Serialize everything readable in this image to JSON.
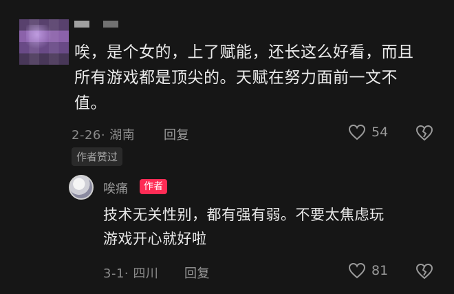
{
  "comment": {
    "text_line1": "唉，是个女的，上了赋能，还长这么好看，而且",
    "text_line2": "所有游戏都是顶尖的。天赋在努力面前一文不",
    "text_line3": "值。",
    "date_location": "2-26· 湖南",
    "reply_label": "回复",
    "likes": "54",
    "author_liked_badge": "作者赞过"
  },
  "reply": {
    "username": "唉痛",
    "author_badge": "作者",
    "text_line1": "技术无关性别，都有强有弱。不要太焦虑玩",
    "text_line2": "游戏开心就好啦",
    "date_location": "3-1· 四川",
    "reply_label": "回复",
    "likes": "81"
  },
  "colors": {
    "background": "#161616",
    "accent": "#fe2c55"
  },
  "icons": [
    "heart-icon",
    "broken-heart-icon"
  ]
}
